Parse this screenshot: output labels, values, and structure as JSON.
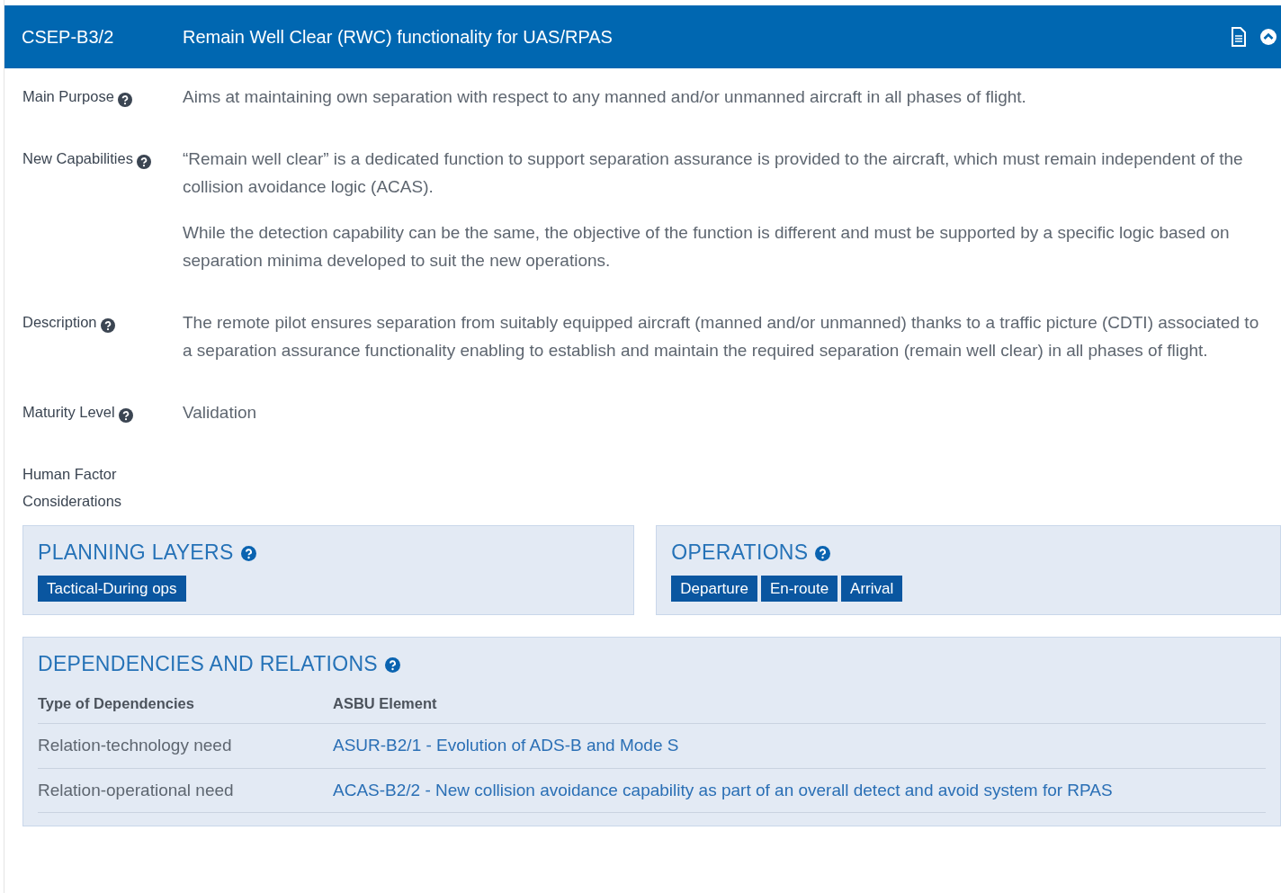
{
  "header": {
    "code": "CSEP-B3/2",
    "title": "Remain Well Clear (RWC) functionality for UAS/RPAS"
  },
  "fields": [
    {
      "label": "Main Purpose",
      "help": true,
      "paragraphs": [
        "Aims at maintaining own separation with respect to any manned and/or unmanned aircraft in all phases of flight."
      ]
    },
    {
      "label": "New Capabilities",
      "help": true,
      "paragraphs": [
        "“Remain well clear” is a dedicated function to support separation assurance is provided to the aircraft, which must remain independent of the collision avoidance logic (ACAS).",
        "While the detection capability can be the same, the objective of the function is different and must be supported by a specific logic based on separation minima developed to suit the new operations."
      ]
    },
    {
      "label": "Description",
      "help": true,
      "paragraphs": [
        "The remote pilot ensures separation from suitably equipped aircraft (manned and/or unmanned) thanks to a traffic picture (CDTI) associated to a separation assurance functionality enabling to establish and maintain the required separation (remain well clear) in all phases of flight."
      ]
    },
    {
      "label": "Maturity Level",
      "help": true,
      "paragraphs": [
        "Validation"
      ]
    },
    {
      "label": "Human Factor Considerations",
      "help": false
    }
  ],
  "planning_layers": {
    "title": "PLANNING LAYERS",
    "tags": [
      "Tactical-During ops"
    ]
  },
  "operations": {
    "title": "OPERATIONS",
    "tags": [
      "Departure",
      "En-route",
      "Arrival"
    ]
  },
  "dependencies": {
    "title": "DEPENDENCIES AND RELATIONS",
    "columns": [
      "Type of Dependencies",
      "ASBU Element"
    ],
    "rows": [
      {
        "type": "Relation-technology need",
        "element": "ASUR-B2/1 - Evolution of ADS-B and Mode S"
      },
      {
        "type": "Relation-operational need",
        "element": "ACAS-B2/2 - New collision avoidance capability as part of an overall detect and avoid system for RPAS"
      }
    ]
  }
}
